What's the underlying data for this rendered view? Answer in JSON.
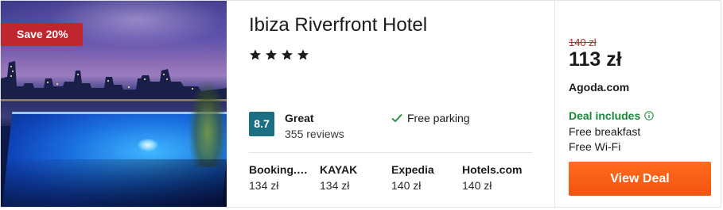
{
  "badge": {
    "label": "Save 20%"
  },
  "hotel": {
    "name": "Ibiza Riverfront Hotel",
    "stars": 4,
    "rating": {
      "score": "8.7",
      "label": "Great",
      "reviews": "355 reviews"
    },
    "amenity": "Free parking"
  },
  "providers": [
    {
      "name": "Booking.…",
      "price": "134 zł"
    },
    {
      "name": "KAYAK",
      "price": "134 zł"
    },
    {
      "name": "Expedia",
      "price": "140 zł"
    },
    {
      "name": "Hotels.com",
      "price": "140 zł"
    }
  ],
  "offer": {
    "old_price": "140 zł",
    "price": "113 zł",
    "source": "Agoda.com",
    "deal_title": "Deal includes",
    "deal_items": [
      "Free breakfast",
      "Free Wi-Fi"
    ],
    "button": "View Deal"
  },
  "colors": {
    "badge": "#c0262e",
    "score": "#1a6f83",
    "deal": "#178a3a",
    "button": "#f2540d"
  }
}
